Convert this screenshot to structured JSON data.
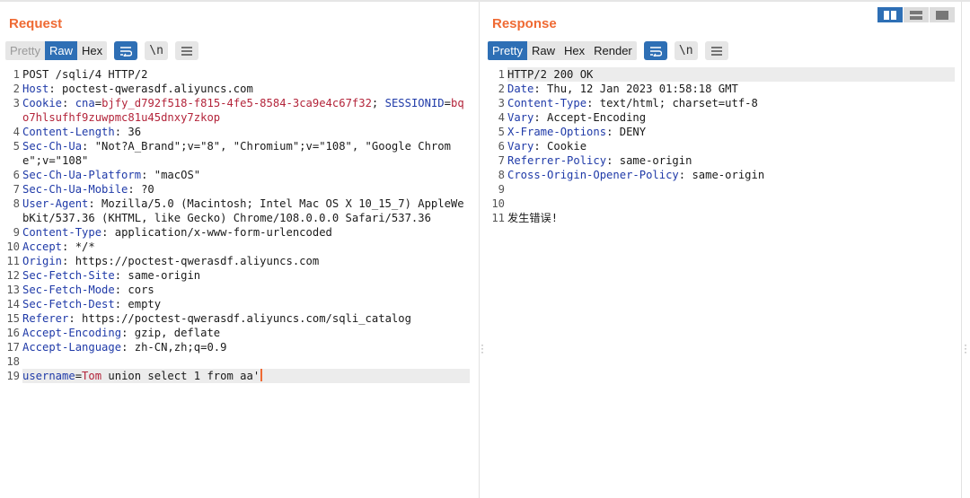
{
  "request": {
    "title": "Request",
    "tabs": [
      "Pretty",
      "Raw",
      "Hex"
    ],
    "icon_newline": "\\n",
    "lines": [
      {
        "n": "1",
        "parts": [
          {
            "t": "POST /sqli/4 HTTP/2",
            "c": ""
          }
        ]
      },
      {
        "n": "2",
        "parts": [
          {
            "t": "Host",
            "c": "hn"
          },
          {
            "t": ": poctest-qwerasdf.aliyuncs.com",
            "c": ""
          }
        ]
      },
      {
        "n": "3",
        "parts": [
          {
            "t": "Cookie",
            "c": "hn"
          },
          {
            "t": ": ",
            "c": ""
          },
          {
            "t": "cna",
            "c": "hn"
          },
          {
            "t": "=",
            "c": ""
          },
          {
            "t": "bjfy_d792f518-f815-4fe5-8584-3ca9e4c67f32",
            "c": "cookiev"
          },
          {
            "t": "; ",
            "c": ""
          },
          {
            "t": "SESSIONID",
            "c": "hn"
          },
          {
            "t": "=",
            "c": ""
          },
          {
            "t": "bqo7hlsufhf9zuwpmc81u45dnxy7zkop",
            "c": "cookiev"
          }
        ]
      },
      {
        "n": "4",
        "parts": [
          {
            "t": "Content-Length",
            "c": "hn"
          },
          {
            "t": ": 36",
            "c": ""
          }
        ]
      },
      {
        "n": "5",
        "parts": [
          {
            "t": "Sec-Ch-Ua",
            "c": "hn"
          },
          {
            "t": ": \"Not?A_Brand\";v=\"8\", \"Chromium\";v=\"108\", \"Google Chrome\";v=\"108\"",
            "c": ""
          }
        ]
      },
      {
        "n": "6",
        "parts": [
          {
            "t": "Sec-Ch-Ua-Platform",
            "c": "hn"
          },
          {
            "t": ": \"macOS\"",
            "c": ""
          }
        ]
      },
      {
        "n": "7",
        "parts": [
          {
            "t": "Sec-Ch-Ua-Mobile",
            "c": "hn"
          },
          {
            "t": ": ?0",
            "c": ""
          }
        ]
      },
      {
        "n": "8",
        "parts": [
          {
            "t": "User-Agent",
            "c": "hn"
          },
          {
            "t": ": Mozilla/5.0 (Macintosh; Intel Mac OS X 10_15_7) AppleWebKit/537.36 (KHTML, like Gecko) Chrome/108.0.0.0 Safari/537.36",
            "c": ""
          }
        ]
      },
      {
        "n": "9",
        "parts": [
          {
            "t": "Content-Type",
            "c": "hn"
          },
          {
            "t": ": application/x-www-form-urlencoded",
            "c": ""
          }
        ]
      },
      {
        "n": "10",
        "parts": [
          {
            "t": "Accept",
            "c": "hn"
          },
          {
            "t": ": */*",
            "c": ""
          }
        ]
      },
      {
        "n": "11",
        "parts": [
          {
            "t": "Origin",
            "c": "hn"
          },
          {
            "t": ": https://poctest-qwerasdf.aliyuncs.com",
            "c": ""
          }
        ]
      },
      {
        "n": "12",
        "parts": [
          {
            "t": "Sec-Fetch-Site",
            "c": "hn"
          },
          {
            "t": ": same-origin",
            "c": ""
          }
        ]
      },
      {
        "n": "13",
        "parts": [
          {
            "t": "Sec-Fetch-Mode",
            "c": "hn"
          },
          {
            "t": ": cors",
            "c": ""
          }
        ]
      },
      {
        "n": "14",
        "parts": [
          {
            "t": "Sec-Fetch-Dest",
            "c": "hn"
          },
          {
            "t": ": empty",
            "c": ""
          }
        ]
      },
      {
        "n": "15",
        "parts": [
          {
            "t": "Referer",
            "c": "hn"
          },
          {
            "t": ": https://poctest-qwerasdf.aliyuncs.com/sqli_catalog",
            "c": ""
          }
        ]
      },
      {
        "n": "16",
        "parts": [
          {
            "t": "Accept-Encoding",
            "c": "hn"
          },
          {
            "t": ": gzip, deflate",
            "c": ""
          }
        ]
      },
      {
        "n": "17",
        "parts": [
          {
            "t": "Accept-Language",
            "c": "hn"
          },
          {
            "t": ": zh-CN,zh;q=0.9",
            "c": ""
          }
        ]
      },
      {
        "n": "18",
        "parts": []
      },
      {
        "n": "19",
        "hl": true,
        "caret": true,
        "parts": [
          {
            "t": "username",
            "c": "hn"
          },
          {
            "t": "=",
            "c": ""
          },
          {
            "t": "Tom",
            "c": "paramv"
          },
          {
            "t": " union select 1 from aa'",
            "c": ""
          }
        ]
      }
    ]
  },
  "response": {
    "title": "Response",
    "tabs": [
      "Pretty",
      "Raw",
      "Hex",
      "Render"
    ],
    "icon_newline": "\\n",
    "lines": [
      {
        "n": "1",
        "hl": true,
        "parts": [
          {
            "t": "HTTP/2 200 OK",
            "c": ""
          }
        ]
      },
      {
        "n": "2",
        "parts": [
          {
            "t": "Date",
            "c": "hn"
          },
          {
            "t": ": Thu, 12 Jan 2023 01:58:18 GMT",
            "c": ""
          }
        ]
      },
      {
        "n": "3",
        "parts": [
          {
            "t": "Content-Type",
            "c": "hn"
          },
          {
            "t": ": text/html; charset=utf-8",
            "c": ""
          }
        ]
      },
      {
        "n": "4",
        "parts": [
          {
            "t": "Vary",
            "c": "hn"
          },
          {
            "t": ": Accept-Encoding",
            "c": ""
          }
        ]
      },
      {
        "n": "5",
        "parts": [
          {
            "t": "X-Frame-Options",
            "c": "hn"
          },
          {
            "t": ": DENY",
            "c": ""
          }
        ]
      },
      {
        "n": "6",
        "parts": [
          {
            "t": "Vary",
            "c": "hn"
          },
          {
            "t": ": Cookie",
            "c": ""
          }
        ]
      },
      {
        "n": "7",
        "parts": [
          {
            "t": "Referrer-Policy",
            "c": "hn"
          },
          {
            "t": ": same-origin",
            "c": ""
          }
        ]
      },
      {
        "n": "8",
        "parts": [
          {
            "t": "Cross-Origin-Opener-Policy",
            "c": "hn"
          },
          {
            "t": ": same-origin",
            "c": ""
          }
        ]
      },
      {
        "n": "9",
        "parts": []
      },
      {
        "n": "10",
        "parts": []
      },
      {
        "n": "11",
        "parts": [
          {
            "t": "发生错误!",
            "c": ""
          }
        ]
      }
    ]
  },
  "colors": {
    "accent": "#ef6a33",
    "active_tab": "#2e6fb5",
    "header_name": "#1f3aa8",
    "value_red": "#b3243a"
  }
}
